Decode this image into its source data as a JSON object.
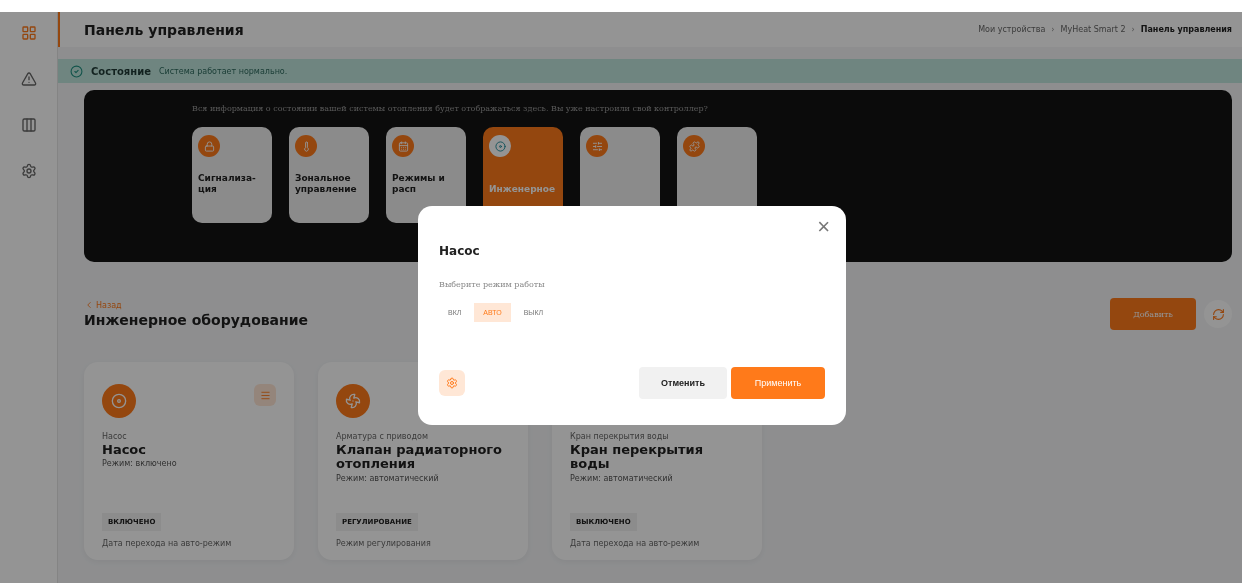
{
  "sidebar": {
    "items": [
      {
        "selected": true
      },
      {
        "selected": false
      },
      {
        "selected": false
      },
      {
        "selected": false
      }
    ]
  },
  "header": {
    "title": "Панель управления",
    "separator": "›",
    "breadcrumbs": [
      "Мои устройства",
      "MyHeat Smart 2",
      "Панель управления"
    ]
  },
  "status": {
    "label": "Состояние",
    "text": "Система работает нормально."
  },
  "banner": {
    "text": "Вся информация о состоянии вашей системы отопления будет отображаться здесь. Вы уже настроили свой контроллер?",
    "tiles": [
      {
        "label": "Сигнализа-ция",
        "selected": false
      },
      {
        "label": "Зональное управление",
        "selected": false
      },
      {
        "label": "Режимы и расп",
        "selected": false
      },
      {
        "label": "Инженерное",
        "selected": true
      },
      {
        "selected": false
      },
      {
        "selected": false
      }
    ]
  },
  "section": {
    "back": "Назад",
    "title": "Инженерное оборудование",
    "add_button": "Добавить"
  },
  "cards": [
    {
      "kind": "pump",
      "caption": "Насос",
      "title": "Насос",
      "mode": "Режим: включено",
      "state": "ВКЛЮЧЕНО",
      "footer": "Дата перехода на авто-режим",
      "menu": true
    },
    {
      "kind": "valve",
      "caption": "Арматура с приводом",
      "title": "Клапан радиаторного отопления",
      "mode": "Режим: автоматический",
      "state": "РЕГУЛИРОВАНИЕ",
      "footer": "Режим регулирования"
    },
    {
      "kind": "shutoff",
      "caption": "Кран перекрытия воды",
      "title": "Кран перекрытия воды",
      "mode": "Режим: автоматический",
      "state": "ВЫКЛЮЧЕНО",
      "footer": "Дата перехода на авто-режим"
    }
  ],
  "dialog": {
    "title": "Насос",
    "prompt": "Выберите режим работы",
    "close": "×",
    "modes": [
      {
        "label": "ВКЛ",
        "selected": false
      },
      {
        "label": "АВТО",
        "selected": true
      },
      {
        "label": "ВЫКЛ",
        "selected": false
      }
    ],
    "cancel": "Отменить",
    "apply": "Применить"
  }
}
